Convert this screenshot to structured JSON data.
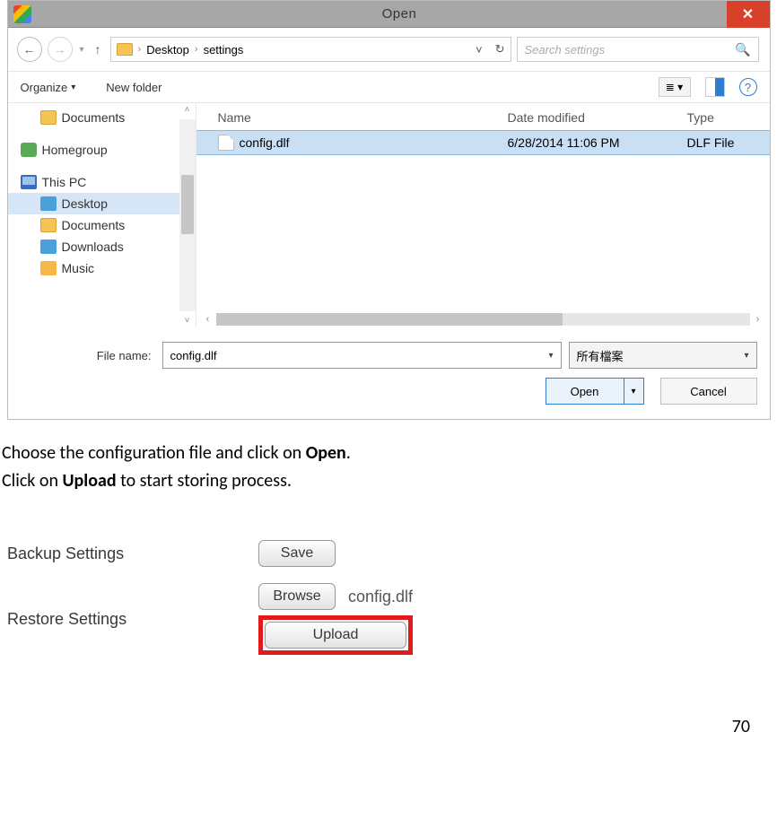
{
  "dialog": {
    "title": "Open",
    "breadcrumb": {
      "root": "Desktop",
      "current": "settings"
    },
    "search_placeholder": "Search settings",
    "toolbar": {
      "organize": "Organize",
      "newfolder": "New folder"
    },
    "tree": {
      "documents": "Documents",
      "homegroup": "Homegroup",
      "thispc": "This PC",
      "desktop": "Desktop",
      "documents2": "Documents",
      "downloads": "Downloads",
      "music": "Music"
    },
    "columns": {
      "name": "Name",
      "date": "Date modified",
      "type": "Type"
    },
    "file": {
      "name": "config.dlf",
      "date": "6/28/2014 11:06 PM",
      "type": "DLF File"
    },
    "filename_label": "File name:",
    "filename_value": "config.dlf",
    "filter_value": "所有檔案",
    "open_btn": "Open",
    "cancel_btn": "Cancel"
  },
  "instructions": {
    "line1a": "Choose the configuration file and click on ",
    "line1b": "Open",
    "line1c": ".",
    "line2a": "Click on ",
    "line2b": "Upload",
    "line2c": " to start storing process."
  },
  "settings": {
    "backup_label": "Backup Settings",
    "restore_label": "Restore Settings",
    "save_btn": "Save",
    "browse_btn": "Browse",
    "upload_btn": "Upload",
    "chosen_file": "config.dlf"
  },
  "page_number": "70"
}
